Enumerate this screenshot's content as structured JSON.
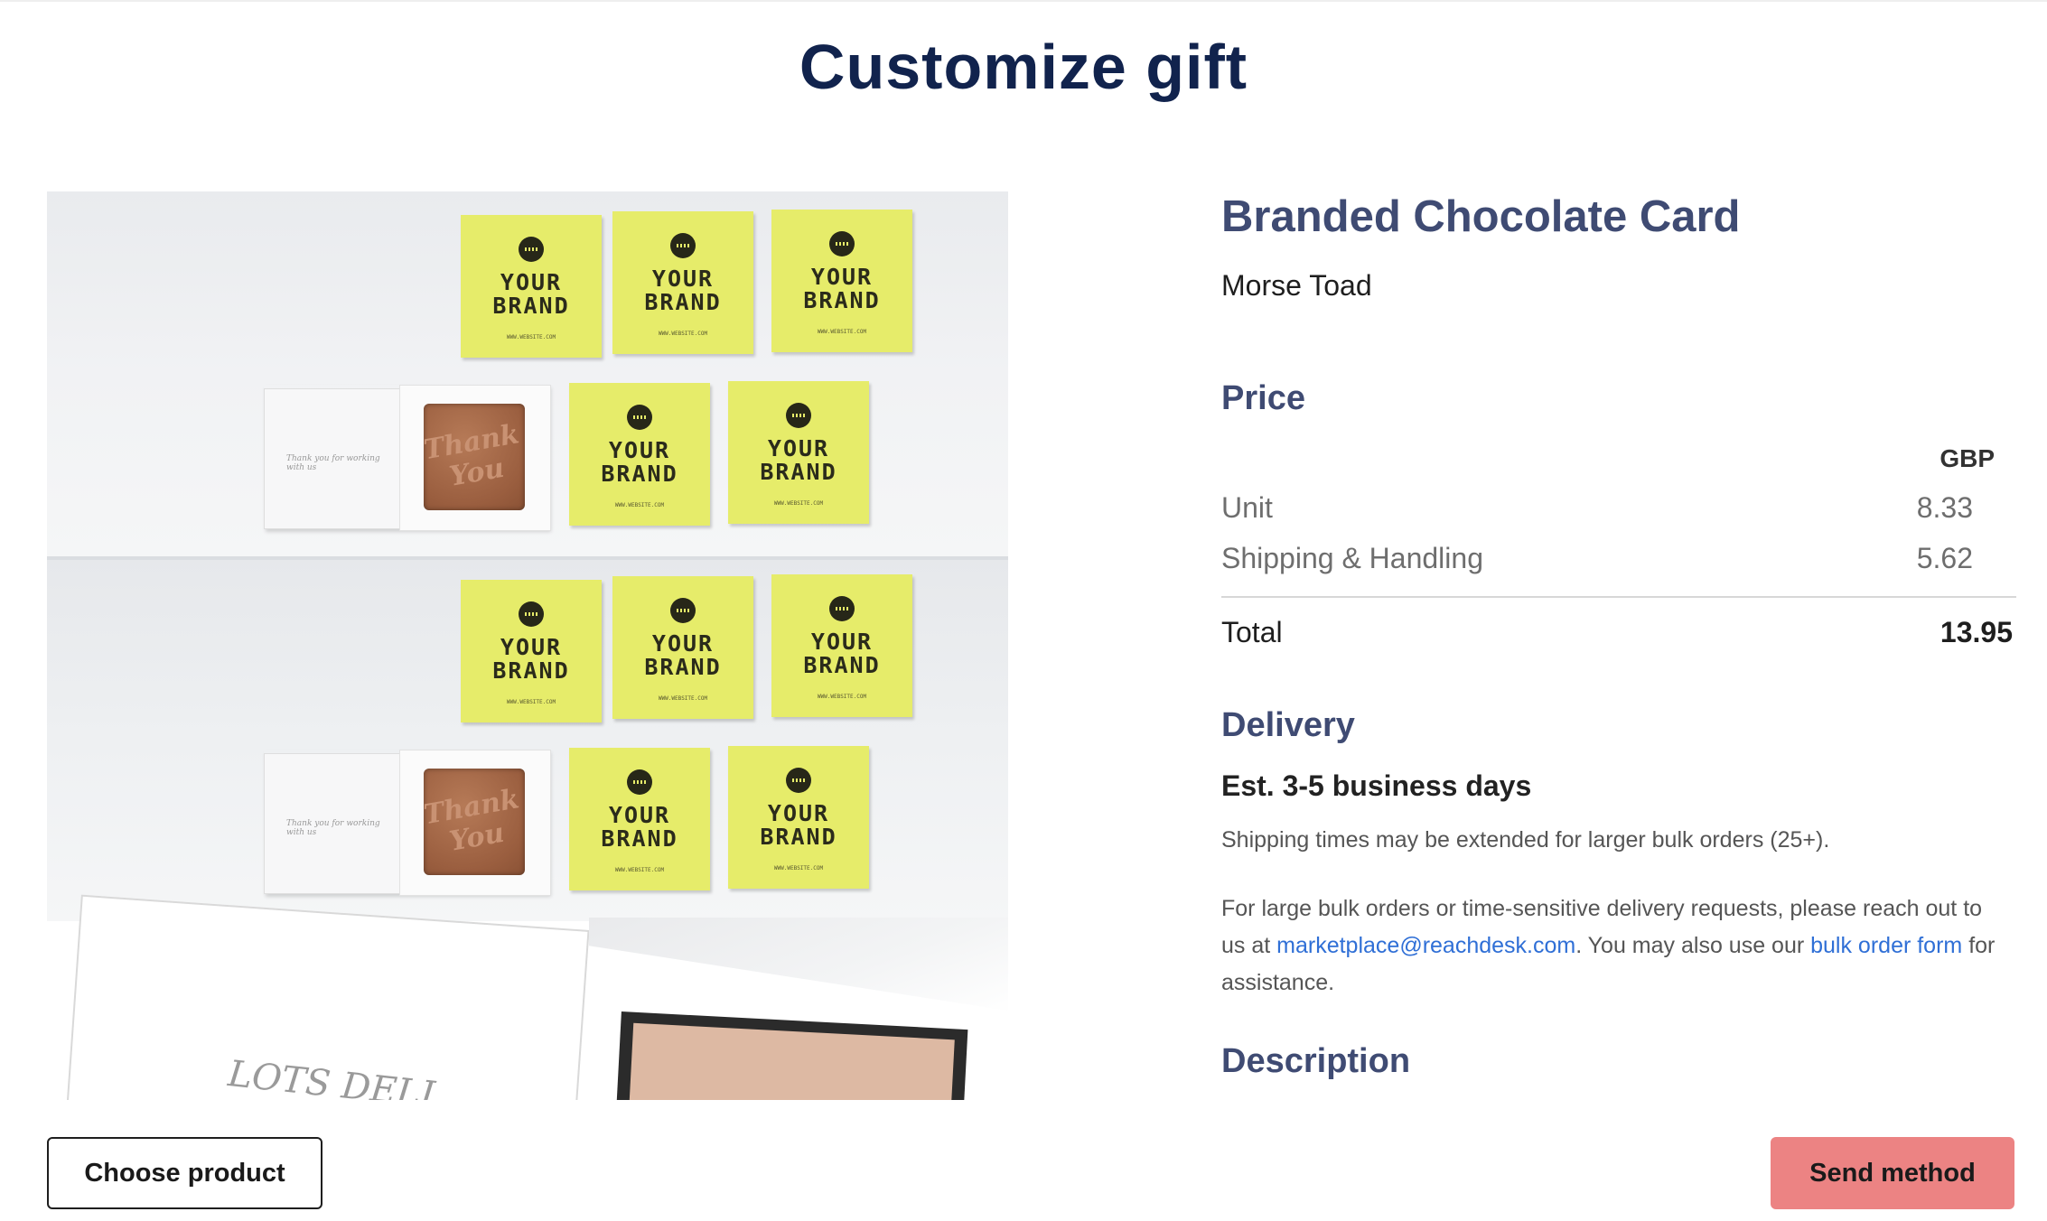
{
  "page": {
    "title": "Customize gift"
  },
  "gallery": {
    "brand_word_1": "YOUR",
    "brand_word_2": "BRAND",
    "brand_site": "WWW.WEBSITE.COM",
    "choc_text": "Thank You",
    "card_script": "Thank you for working with us",
    "scribble": "LOTS DELI..."
  },
  "product": {
    "name": "Branded Chocolate Card",
    "vendor": "Morse Toad"
  },
  "price": {
    "heading": "Price",
    "currency": "GBP",
    "unit_label": "Unit",
    "unit_value": "8.33",
    "shipping_label": "Shipping & Handling",
    "shipping_value": "5.62",
    "total_label": "Total",
    "total_value": "13.95"
  },
  "delivery": {
    "heading": "Delivery",
    "estimate": "Est. 3-5 business days",
    "bulk_note": "Shipping times may be extended for larger bulk orders (25+).",
    "contact_prefix": "For large bulk orders or time-sensitive delivery requests, please reach out to us at ",
    "email": "marketplace@reachdesk.com",
    "contact_middle": ". You may also use our ",
    "bulk_form_link": "bulk order form",
    "contact_suffix": " for assistance."
  },
  "description": {
    "heading": "Description"
  },
  "footer": {
    "choose_product": "Choose product",
    "send_method": "Send method"
  },
  "colors": {
    "title": "#11234d",
    "heading": "#3f4b73",
    "link": "#2f6fd6",
    "send_button": "#ec8383",
    "brand_card": "#e6ec6a"
  }
}
